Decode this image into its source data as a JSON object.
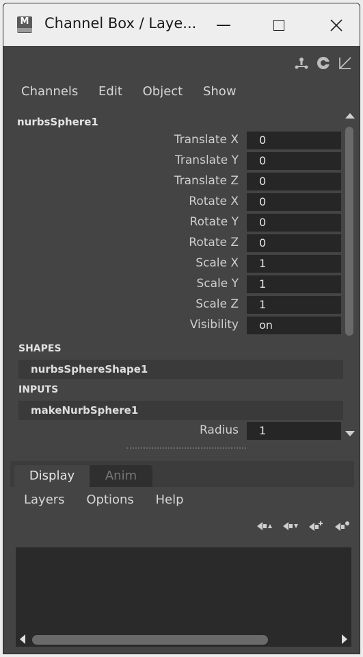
{
  "window": {
    "title": "Channel Box / Laye...",
    "app_icon_letter": "M"
  },
  "top_icons": [
    "channel-box-layout-icon",
    "attribute-editor-icon",
    "tool-settings-icon"
  ],
  "menubar": [
    "Channels",
    "Edit",
    "Object",
    "Show"
  ],
  "channel_box": {
    "object_name": "nurbsSphere1",
    "attributes": [
      {
        "label": "Translate X",
        "value": "0"
      },
      {
        "label": "Translate Y",
        "value": "0"
      },
      {
        "label": "Translate Z",
        "value": "0"
      },
      {
        "label": "Rotate X",
        "value": "0"
      },
      {
        "label": "Rotate Y",
        "value": "0"
      },
      {
        "label": "Rotate Z",
        "value": "0"
      },
      {
        "label": "Scale X",
        "value": "1"
      },
      {
        "label": "Scale Y",
        "value": "1"
      },
      {
        "label": "Scale Z",
        "value": "1"
      },
      {
        "label": "Visibility",
        "value": "on"
      }
    ],
    "shapes_title": "SHAPES",
    "shape_node": "nurbsSphereShape1",
    "inputs_title": "INPUTS",
    "input_node": "makeNurbSphere1",
    "input_attributes": [
      {
        "label": "Radius",
        "value": "1"
      }
    ]
  },
  "layer_editor": {
    "tabs": [
      "Display",
      "Anim"
    ],
    "active_tab": "Display",
    "menu": [
      "Layers",
      "Options",
      "Help"
    ],
    "icons": [
      "move-layer-up-icon",
      "move-layer-down-icon",
      "new-empty-layer-icon",
      "new-layer-from-selected-icon"
    ]
  },
  "colors": {
    "panel_bg": "#444444",
    "field_bg": "#262626",
    "titlebar_bg": "#eeeeee"
  }
}
